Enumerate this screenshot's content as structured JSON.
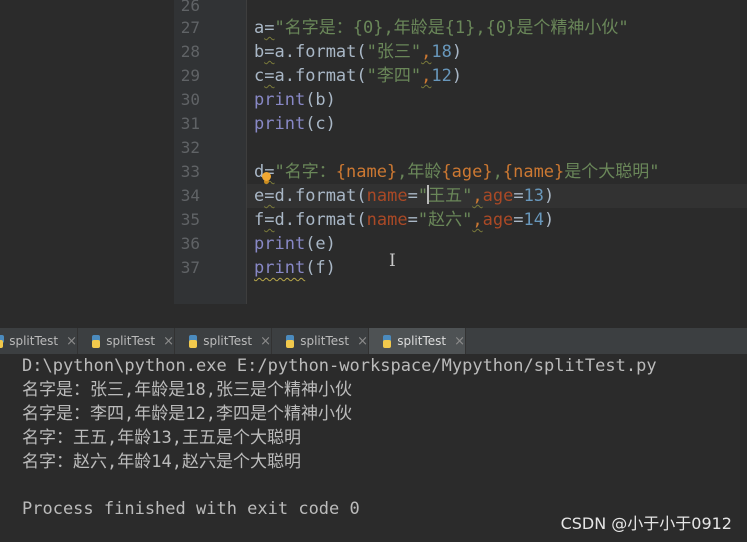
{
  "editor": {
    "line_numbers": [
      "26",
      "27",
      "28",
      "29",
      "30",
      "31",
      "32",
      "33",
      "34",
      "35",
      "36",
      "37"
    ],
    "lines": {
      "l27": {
        "var": "a",
        "op": "=",
        "str": "\"名字是：{0},年龄是{1},{0}是个精神小伙\""
      },
      "l28": {
        "var": "b",
        "op": "=",
        "obj": "a",
        "method": ".format(",
        "str": "\"张三\"",
        "comma": ",",
        "num": "18",
        "close": ")"
      },
      "l29": {
        "var": "c",
        "op": "=",
        "obj": "a",
        "method": ".format(",
        "str": "\"李四\"",
        "comma": ",",
        "num": "12",
        "close": ")"
      },
      "l30": {
        "fn": "print",
        "arg": "(b)"
      },
      "l31": {
        "fn": "print",
        "arg": "(c)"
      },
      "l33": {
        "var": "d",
        "op": "=",
        "str_open": "\"名字：",
        "f1": "{name}",
        "s1": ",年龄",
        "f2": "{age}",
        "s2": ",",
        "f3": "{name}",
        "s3": "是个大聪明\""
      },
      "l34": {
        "var": "e",
        "op": "=",
        "obj": "d",
        "method": ".format(",
        "p1": "name",
        "eq1": "=",
        "str_q": "\"",
        "str_rest": "王五\"",
        "comma": ",",
        "p2": "age",
        "eq2": "=",
        "num": "13",
        "close": ")"
      },
      "l35": {
        "var": "f",
        "op": "=",
        "obj": "d",
        "method": ".format(",
        "p1": "name",
        "eq1": "=",
        "str": "\"赵六\"",
        "comma": ",",
        "p2": "age",
        "eq2": "=",
        "num": "14",
        "close": ")"
      },
      "l36": {
        "fn": "print",
        "arg": "(e)"
      },
      "l37": {
        "fn": "print",
        "arg": "(f)"
      }
    }
  },
  "tabs": [
    {
      "label": "splitTest",
      "close": "×"
    },
    {
      "label": "splitTest",
      "close": "×"
    },
    {
      "label": "splitTest",
      "close": "×"
    },
    {
      "label": "splitTest",
      "close": "×"
    },
    {
      "label": "splitTest",
      "close": "×"
    }
  ],
  "console": {
    "lines": [
      "D:\\python\\python.exe E:/python-workspace/Mypython/splitTest.py",
      "名字是：张三,年龄是18,张三是个精神小伙",
      "名字是：李四,年龄是12,李四是个精神小伙",
      "名字：王五,年龄13,王五是个大聪明",
      "名字：赵六,年龄14,赵六是个大聪明",
      "",
      "Process finished with exit code 0"
    ]
  },
  "watermark": "CSDN @小于小于0912",
  "colors": {
    "editor_bg": "#2b2b2b",
    "gutter_bg": "#313335",
    "string": "#6a8759",
    "number": "#6897bb",
    "builtin": "#8888c6",
    "param": "#aa4926",
    "format_field": "#cc7832"
  },
  "icons": {
    "tab": "python-file-icon",
    "bulb": "intention-bulb-icon",
    "cursor": "text-cursor-icon"
  }
}
